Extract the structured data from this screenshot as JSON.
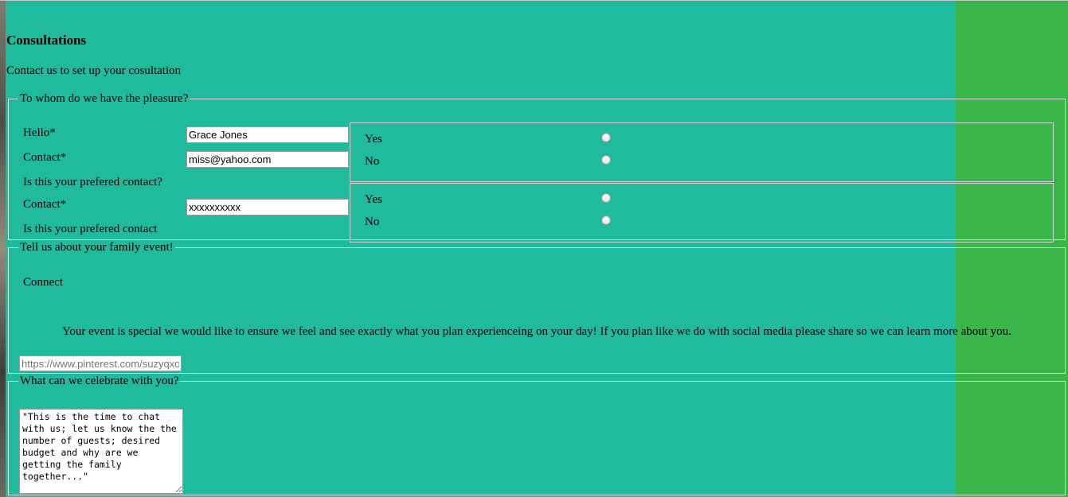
{
  "page": {
    "title": "Consultations",
    "intro": "Contact us to set up your cosultation"
  },
  "contact_section": {
    "legend": "To whom do we have the pleasure?",
    "name_label": "Hello*",
    "name_value": "Grace Jones",
    "email_label": "Contact*",
    "email_value": "miss@yahoo.com",
    "email_pref_question": "Is this your prefered contact?",
    "phone_label": "Contact*",
    "phone_value": "xxxxxxxxxx",
    "phone_pref_question": "Is this your prefered contact",
    "email_pref_options": [
      "Yes",
      "No"
    ],
    "phone_pref_options": [
      "Yes",
      "No"
    ]
  },
  "event_section": {
    "legend": "Tell us about your family event!",
    "connect_label": "Connect",
    "description": "Your event is special we would like to ensure we feel and see exactly what you plan experienceing on your day! If you plan like we do with social media please share so we can learn more about you.",
    "url_placeholder": "https://www.pinterest.com/suzyqxo"
  },
  "celebrate_section": {
    "legend": "What can we celebrate with you?",
    "message_placeholder": "\"This is the time to chat with us; let us know the the number of guests; desired budget and why are we getting the family together...\""
  },
  "colors": {
    "teal_panel": "#20ba9d",
    "green_side": "#3ab54a"
  }
}
